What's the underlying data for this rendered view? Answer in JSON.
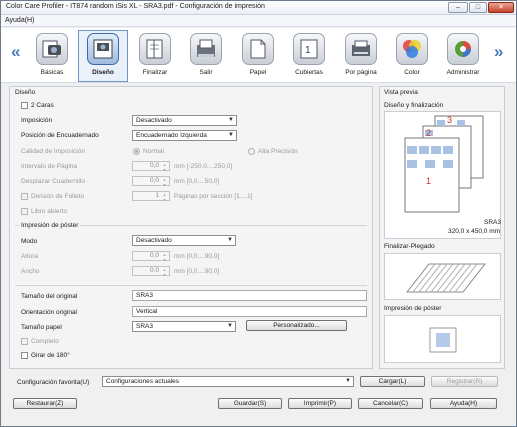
{
  "window": {
    "title": "Color Care Profiler - IT874 random iSis XL - SRA3.pdf - Configuración de impresión",
    "min_label": "–",
    "max_label": "□",
    "close_label": "✕"
  },
  "menu": {
    "help": "Ayuda(H)"
  },
  "toolbar": {
    "prev_arrow": "«",
    "next_arrow": "»",
    "items": [
      {
        "label": "Básicas",
        "icon": "basic-settings-icon"
      },
      {
        "label": "Diseño",
        "icon": "layout-icon"
      },
      {
        "label": "Finalizar",
        "icon": "finishing-icon"
      },
      {
        "label": "Salir",
        "icon": "output-tray-icon"
      },
      {
        "label": "Papel",
        "icon": "paper-icon"
      },
      {
        "label": "Cubiertas",
        "icon": "covers-icon"
      },
      {
        "label": "Por página",
        "icon": "per-page-icon"
      },
      {
        "label": "Color",
        "icon": "color-icon"
      },
      {
        "label": "Administrar",
        "icon": "administer-icon"
      }
    ],
    "selected": "Diseño"
  },
  "layout": {
    "group_title": "Diseño",
    "two_sided": "2 Caras",
    "imposition_label": "Imposición",
    "imposition_value": "Desactivado",
    "binding_label": "Posición de Encuadernado",
    "binding_value": "Encuadernado Izquierda",
    "quality_label": "Calidad de Imposición",
    "quality_normal": "Normal",
    "quality_high": "Alta Precisión",
    "page_interval_label": "Intervalo de Página",
    "page_interval_value": "0,0",
    "page_interval_unit": "mm [-250,0....250,0]",
    "creep_label": "Desplazar Cuadernillo",
    "creep_value": "0,0",
    "creep_unit": "mm [0,0....50,0]",
    "booklet_label": "División de Folleto",
    "booklet_value": "1",
    "booklet_unit": "Páginas por sección [1....1]",
    "open_book": "Libro abierto",
    "poster_title": "Impresión de póster",
    "mode_label": "Modo",
    "mode_value": "Desactivado",
    "height_label": "Altura",
    "height_value": "0,0",
    "height_unit": "mm [0,0....90,0]",
    "width_label": "Ancho",
    "width_value": "0,0",
    "width_unit": "mm [0,0....90,0]",
    "original_size_label": "Tamaño del original",
    "original_size_value": "SRA3",
    "orientation_label": "Orientación original",
    "orientation_value": "Vertical",
    "paper_size_label": "Tamaño papel",
    "paper_size_value": "SRA3",
    "custom_button": "Personalizado...",
    "complete_label": "Completo",
    "rotate_label": "Girar de 180°"
  },
  "preview": {
    "title": "Vista previa",
    "layout_title": "Diseño y finalización",
    "page_numbers": [
      "3",
      "2",
      "1"
    ],
    "paper_name": "SRA3",
    "paper_dims": "320,0 x 450,0 mm",
    "fold_title": "Finalizar-Plegado",
    "poster_title": "Impresión de póster"
  },
  "favorites": {
    "label": "Configuración favorita(U)",
    "value": "Configuraciones actuales",
    "load_button": "Cargar(L)",
    "register_button": "Registrar(R)"
  },
  "footer": {
    "restore": "Restaurar(Z)",
    "save": "Guardar(S)",
    "print": "Imprimir(P)",
    "cancel": "Cancelar(C)",
    "help": "Ayuda(H)"
  }
}
